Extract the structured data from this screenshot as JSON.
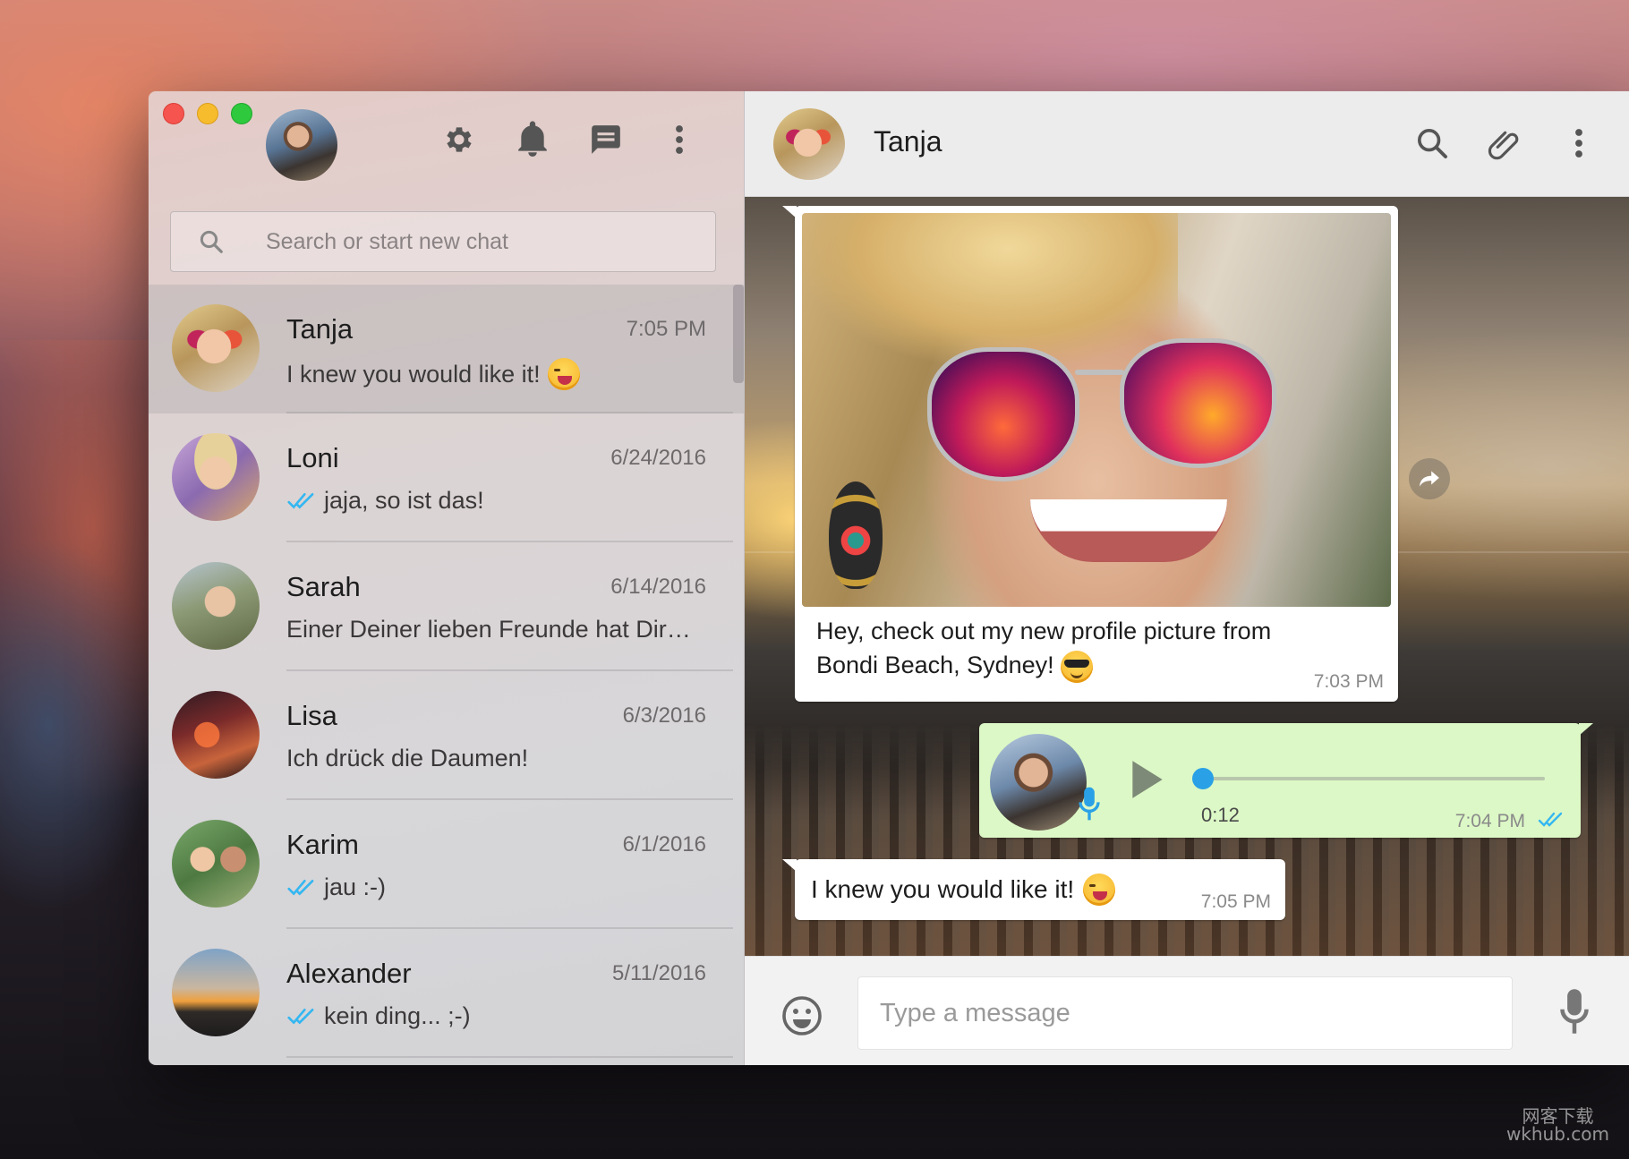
{
  "window": {
    "traffic_lights": [
      "close",
      "minimize",
      "maximize"
    ]
  },
  "sidebar": {
    "tools": [
      "settings-icon",
      "notifications-icon",
      "new-chat-icon",
      "menu-icon"
    ],
    "search": {
      "placeholder": "Search or start new chat"
    },
    "chats": [
      {
        "name": "Tanja",
        "time": "7:05 PM",
        "preview": "I knew you would like it!",
        "emoji": "wink",
        "read_ticks": false,
        "active": true
      },
      {
        "name": "Loni",
        "time": "6/24/2016",
        "preview": "jaja, so ist das!",
        "read_ticks": true
      },
      {
        "name": "Sarah",
        "time": "6/14/2016",
        "preview": "Einer Deiner lieben Freunde hat Dir…",
        "read_ticks": false
      },
      {
        "name": "Lisa",
        "time": "6/3/2016",
        "preview": "Ich drück die Daumen!",
        "read_ticks": false
      },
      {
        "name": "Karim",
        "time": "6/1/2016",
        "preview": "jau :-)",
        "read_ticks": true
      },
      {
        "name": "Alexander",
        "time": "5/11/2016",
        "preview": "kein ding... ;-)",
        "read_ticks": true
      }
    ]
  },
  "chat": {
    "contact_name": "Tanja",
    "header_tools": [
      "search-icon",
      "attach-icon",
      "menu-icon"
    ],
    "messages": {
      "image_caption": "Hey, check out my new profile picture from Bondi Beach, Sydney!",
      "image_time": "7:03 PM",
      "voice_duration": "0:12",
      "voice_time": "7:04 PM",
      "voice_progress": 0,
      "text": "I knew you would like it!",
      "text_time": "7:05 PM"
    },
    "composer": {
      "placeholder": "Type a message"
    }
  },
  "colors": {
    "read_tick": "#34b7f1",
    "outgoing_bubble": "#dcf8c6",
    "accent": "#2aa1e6"
  },
  "watermark": {
    "line1": "网客下载",
    "line2": "wkhub.com"
  }
}
